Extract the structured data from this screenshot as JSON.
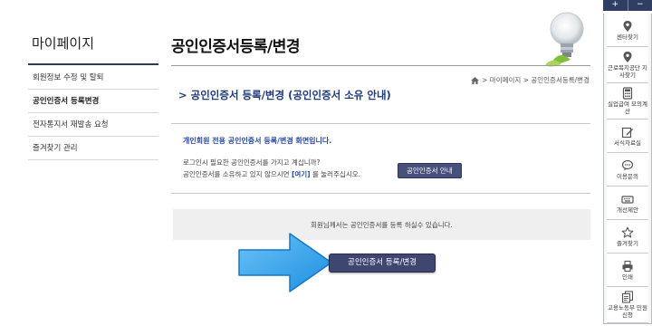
{
  "sidebar": {
    "title": "마이페이지",
    "items": [
      {
        "label": "회원정보 수정 및 탈퇴"
      },
      {
        "label": "공인인증서 등록변경"
      },
      {
        "label": "전자통지서 재발송 요청"
      },
      {
        "label": "즐겨찾기 관리"
      }
    ]
  },
  "header": {
    "title": "공인인증서등록/변경"
  },
  "breadcrumb": {
    "icon": "home-icon",
    "path": "> 마이페이지 > 공인인증서등록/변경"
  },
  "section": {
    "title": "공인인증서 등록/변경 (공인인증서 소유 안내)"
  },
  "info": {
    "line1": "개인회원 전용 공인인증서 등록/변경 화면입니다.",
    "line2": "로그인시 필요한 공인인증서를 가지고 계십니까?",
    "line3_prefix": "공인인증서를 소유하고 있지 않으시면",
    "line3_link": "[여기]",
    "line3_suffix": "를 눌러주십시오.",
    "guide_button": "공인인증서 안내"
  },
  "notice": "회원님께서는 공인인증서를 등록 하실수 있습니다.",
  "register_button": "공인인증서 등록/변경",
  "quickbar": {
    "plus": "+",
    "minus": "−",
    "items": [
      {
        "label": "센터찾기",
        "icon": "location-pin-icon"
      },
      {
        "label": "근로복지공단 지사찾기",
        "icon": "location-pin-icon"
      },
      {
        "label": "실업급여 모의계산",
        "icon": "calculator-icon"
      },
      {
        "label": "서식자료실",
        "icon": "edit-icon"
      },
      {
        "label": "이용문의",
        "icon": "chat-icon"
      },
      {
        "label": "개선제안",
        "icon": "keyboard-icon"
      },
      {
        "label": "즐겨찾기",
        "icon": "star-icon"
      },
      {
        "label": "인쇄",
        "icon": "print-icon"
      },
      {
        "label": "고용노동부 민원신청",
        "icon": "document-icon"
      }
    ]
  },
  "colors": {
    "accent": "#1e3a78",
    "button": "#3f4670",
    "arrow": "#2aa3f0"
  }
}
